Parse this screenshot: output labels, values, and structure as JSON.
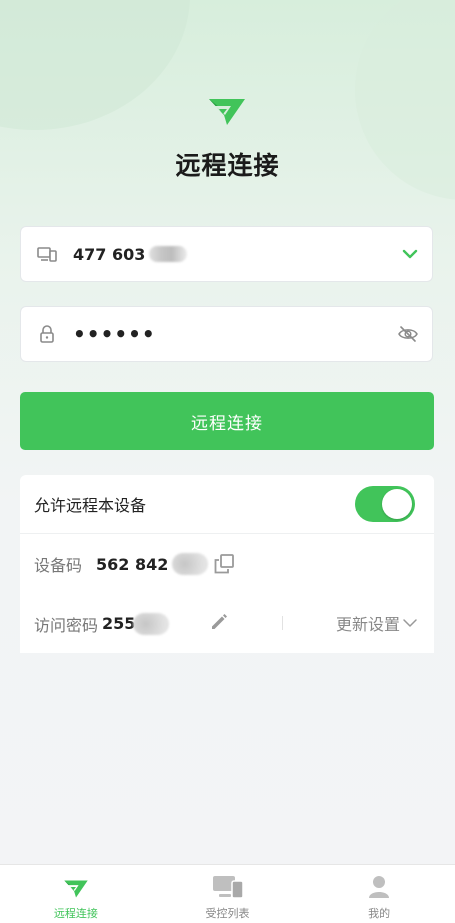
{
  "colors": {
    "accent": "#41c45a",
    "background": "#f3f4f6"
  },
  "header": {
    "title": "远程连接"
  },
  "device_field": {
    "icon": "devices-icon",
    "value": "477 603",
    "trail_icon": "chevron-down-icon"
  },
  "password_field": {
    "icon": "lock-icon",
    "value": "••••••",
    "trail_icon": "eye-off-icon"
  },
  "connect_button": {
    "label": "远程连接"
  },
  "settings_card": {
    "allow_label": "允许远程本设备",
    "allow_enabled": true,
    "device_code_label": "设备码",
    "device_code_value": "562 842",
    "access_password_label": "访问密码",
    "access_password_value": "255",
    "update_label": "更新设置"
  },
  "tabbar": {
    "tabs": [
      {
        "label": "远程连接",
        "icon": "remote-logo-icon",
        "active": true
      },
      {
        "label": "受控列表",
        "icon": "devices-icon",
        "active": false
      },
      {
        "label": "我的",
        "icon": "user-icon",
        "active": false
      }
    ]
  }
}
